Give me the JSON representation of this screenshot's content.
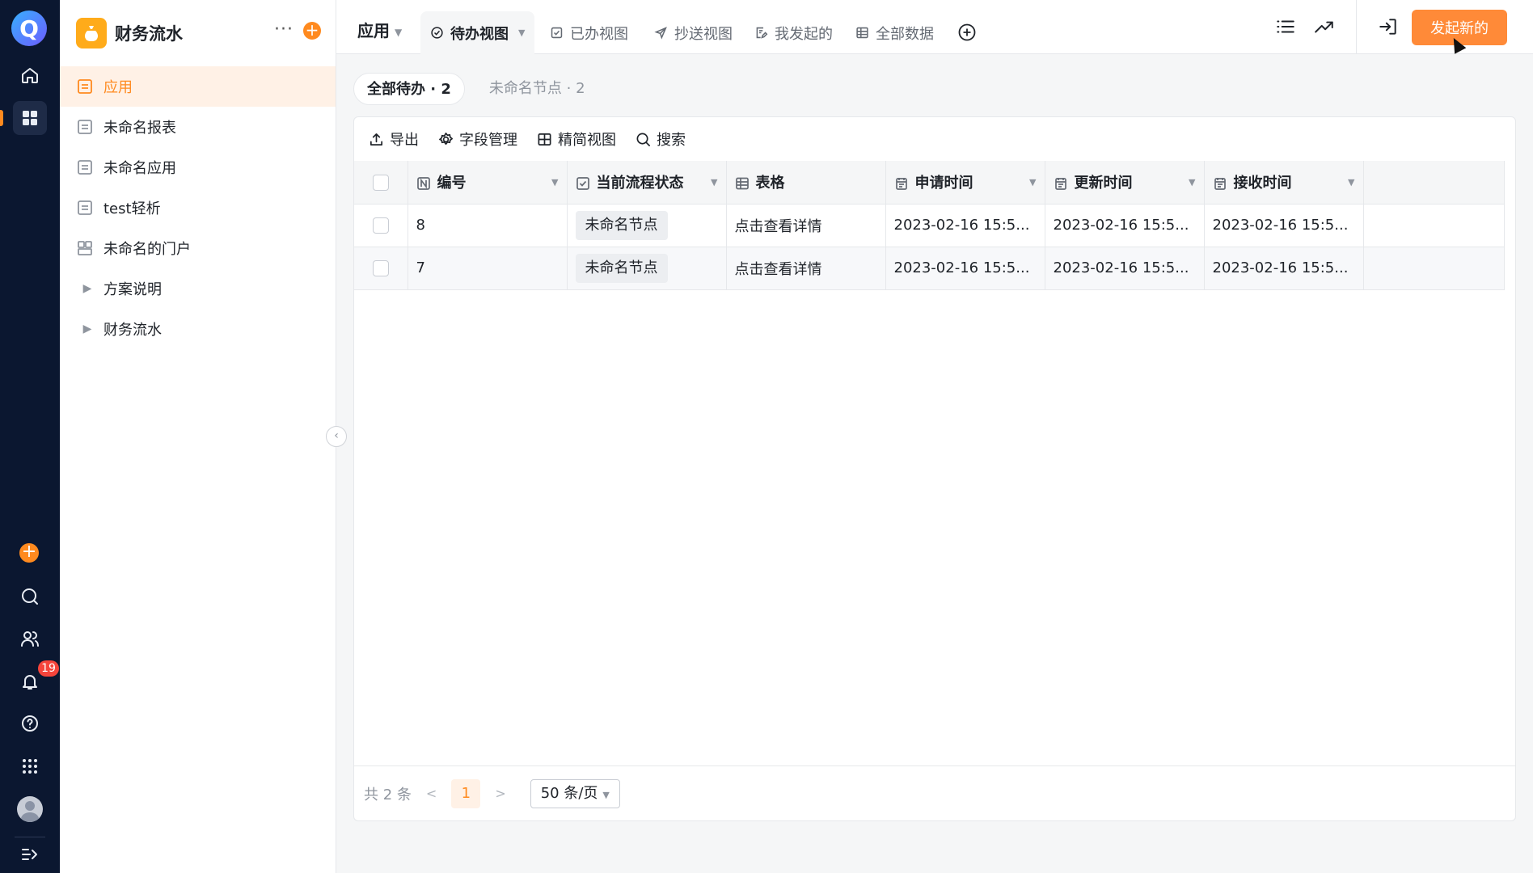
{
  "rail": {
    "logo_letter": "Q",
    "icons": [
      "logo-icon",
      "home-icon",
      "apps-grid-icon",
      "add-icon",
      "search-icon",
      "contacts-icon",
      "bell-icon",
      "help-icon",
      "app-launcher-icon",
      "avatar",
      "expand-icon"
    ],
    "notification_count": "19",
    "accent": "#ff8a1f"
  },
  "sidebar": {
    "app_name": "财务流水",
    "app_icon": "money-bag-icon",
    "items": [
      {
        "label": "应用",
        "icon": "form-icon",
        "active": true
      },
      {
        "label": "未命名报表",
        "icon": "form-icon"
      },
      {
        "label": "未命名应用",
        "icon": "form-icon"
      },
      {
        "label": "test轻析",
        "icon": "form-icon"
      },
      {
        "label": "未命名的门户",
        "icon": "portal-icon"
      },
      {
        "label": "方案说明",
        "icon": "chevron-right-icon"
      },
      {
        "label": "财务流水",
        "icon": "chevron-right-icon"
      }
    ]
  },
  "topbar": {
    "app_tab": "应用",
    "views": [
      {
        "label": "待办视图",
        "icon": "check-circle-icon",
        "active": true
      },
      {
        "label": "已办视图",
        "icon": "checkbox-icon"
      },
      {
        "label": "抄送视图",
        "icon": "send-icon"
      },
      {
        "label": "我发起的",
        "icon": "edit-doc-icon"
      },
      {
        "label": "全部数据",
        "icon": "table-icon"
      }
    ],
    "new_button": "发起新的",
    "brand_color": "#ff8a38"
  },
  "filters": [
    {
      "label": "全部待办 · 2",
      "active": true
    },
    {
      "label": "未命名节点 · 2"
    }
  ],
  "toolbar": {
    "export": "导出",
    "fields": "字段管理",
    "compact": "精简视图",
    "search": "搜索"
  },
  "table": {
    "columns": [
      {
        "label": "编号",
        "icon": "number-field-icon"
      },
      {
        "label": "当前流程状态",
        "icon": "checkbox-icon"
      },
      {
        "label": "表格",
        "icon": "table-icon"
      },
      {
        "label": "申请时间",
        "icon": "calendar-icon"
      },
      {
        "label": "更新时间",
        "icon": "calendar-icon"
      },
      {
        "label": "接收时间",
        "icon": "calendar-icon"
      }
    ],
    "rows": [
      {
        "id": "8",
        "status": "未命名节点",
        "form": "点击查看详情",
        "applied": "2023-02-16 15:5...",
        "updated": "2023-02-16 15:5...",
        "received": "2023-02-16 15:5..."
      },
      {
        "id": "7",
        "status": "未命名节点",
        "form": "点击查看详情",
        "applied": "2023-02-16 15:5...",
        "updated": "2023-02-16 15:5...",
        "received": "2023-02-16 15:5..."
      }
    ]
  },
  "footer": {
    "total": "共 2 条",
    "prev": "<",
    "current_page": "1",
    "next": ">",
    "page_size": "50 条/页"
  }
}
